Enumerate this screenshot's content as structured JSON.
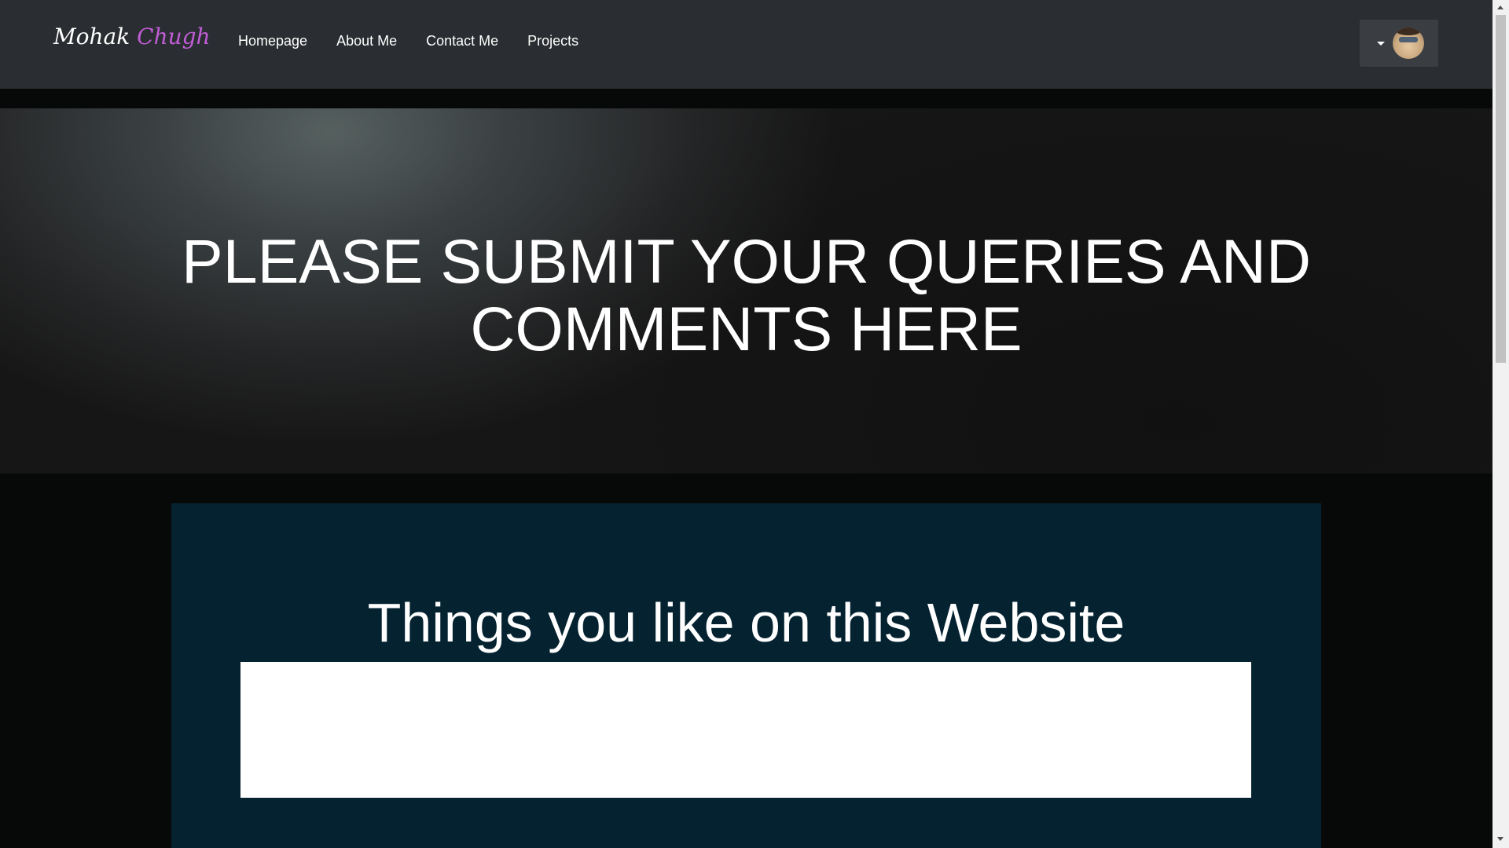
{
  "navbar": {
    "brand_first": "Mohak",
    "brand_last": "Chugh",
    "links": [
      {
        "label": "Homepage"
      },
      {
        "label": "About Me"
      },
      {
        "label": "Contact Me"
      },
      {
        "label": "Projects"
      }
    ],
    "user_menu": {
      "caret_icon": "caret-down-icon",
      "avatar_icon": "user-avatar"
    }
  },
  "hero": {
    "title": "PLEASE SUBMIT YOUR QUERIES AND COMMENTS HERE"
  },
  "form": {
    "likes_heading": "Things you like on this Website",
    "likes_value": ""
  },
  "colors": {
    "navbar_bg": "#2a2d31",
    "brand_accent": "#c15ed6",
    "panel_bg": "#052230",
    "page_bg": "#070808"
  }
}
